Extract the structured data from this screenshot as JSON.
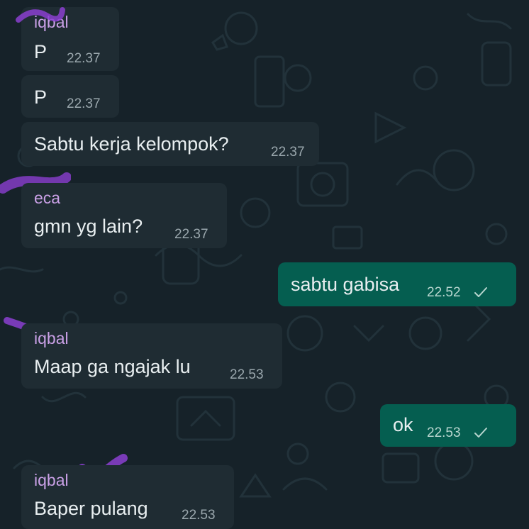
{
  "colors": {
    "background": "#162229",
    "incoming_bubble": "#1f2c33",
    "outgoing_bubble": "#055e50",
    "sender_name": "#c9a0e6",
    "scribble": "#8b3fd0"
  },
  "messages": [
    {
      "sender": "iqbal",
      "text": "P",
      "time": "22.37"
    },
    {
      "text": "P",
      "time": "22.37"
    },
    {
      "text": "Sabtu kerja kelompok?",
      "time": "22.37"
    },
    {
      "sender": "eca",
      "text": "gmn yg lain?",
      "time": "22.37"
    },
    {
      "text": "sabtu gabisa",
      "time": "22.52",
      "status_icon": "check-icon"
    },
    {
      "sender": "iqbal",
      "text": "Maap ga ngajak lu",
      "time": "22.53"
    },
    {
      "text": "ok",
      "time": "22.53",
      "status_icon": "check-icon"
    },
    {
      "sender": "iqbal",
      "text": "Baper pulang",
      "time": "22.53"
    }
  ]
}
